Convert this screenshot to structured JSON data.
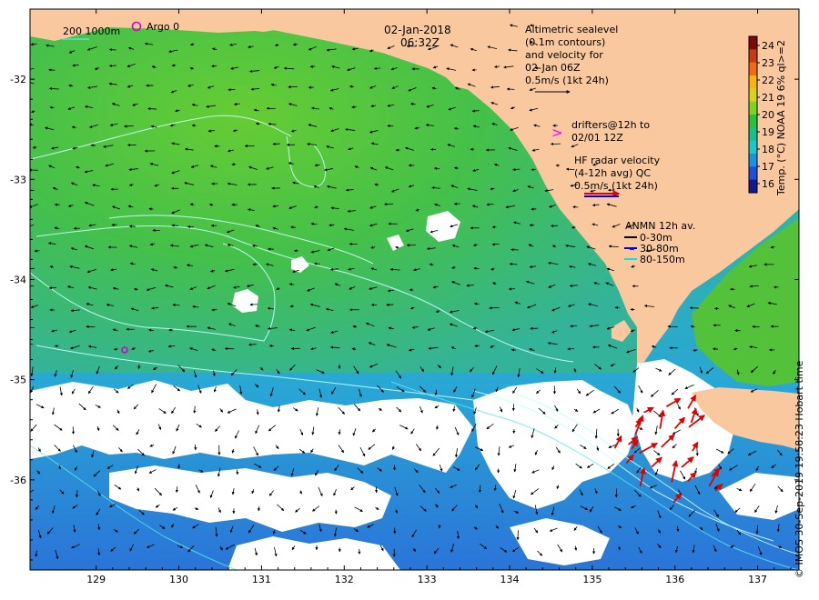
{
  "map": {
    "date": "02-Jan-2018",
    "time": "06:32Z",
    "x_ticks": [
      "129",
      "130",
      "131",
      "132",
      "133",
      "134",
      "135",
      "136",
      "137"
    ],
    "y_ticks": [
      "-32",
      "-33",
      "-34",
      "-35",
      "-36"
    ],
    "extent": {
      "lon": [
        128.2,
        137.5
      ],
      "lat": [
        -36.9,
        -31.3
      ]
    },
    "colors": {
      "land": "#f9c89f",
      "cloud": "#ffffff",
      "sea_warm": "#66cc33",
      "sea_cool": "#33bbaa"
    }
  },
  "legend": {
    "depth_contours": "200  1000m",
    "argo": "Argo 0",
    "altimetry": {
      "lines": [
        "Altimetric sealevel",
        "(0.1m contours)",
        "and velocity for",
        "02-Jan 06Z",
        "0.5m/s (1kt 24h)"
      ]
    },
    "drifters": {
      "symbol": ">",
      "lines": [
        "drifters@12h to",
        "02/01 12Z"
      ]
    },
    "hf_radar": {
      "lines": [
        "HF radar velocity",
        "(4-12h avg) QC",
        "0.5m/s (1kt 24h)"
      ]
    },
    "anmn": {
      "title": "ANMN 12h av.",
      "items": [
        {
          "label": "0-30m",
          "color": "#000000"
        },
        {
          "label": "30-80m",
          "color": "#0000dd"
        },
        {
          "label": "80-150m",
          "color": "#00e5e5"
        }
      ]
    }
  },
  "colorbar": {
    "ticks": [
      "24",
      "23",
      "22",
      "21",
      "20",
      "19",
      "18",
      "17",
      "16"
    ],
    "label": "Temp. (°C) NOAA 19 6% ql>=2",
    "colors": [
      "#7a0a0a",
      "#c83a10",
      "#f06c12",
      "#f9b20e",
      "#d7d21b",
      "#7ed321",
      "#26c23c",
      "#16c08a",
      "#17c8cc",
      "#1794e0",
      "#1f4fd8",
      "#121a8c"
    ]
  },
  "credit": "© IMOS 30-Sep-2019 19:58:23 Hobart time"
}
